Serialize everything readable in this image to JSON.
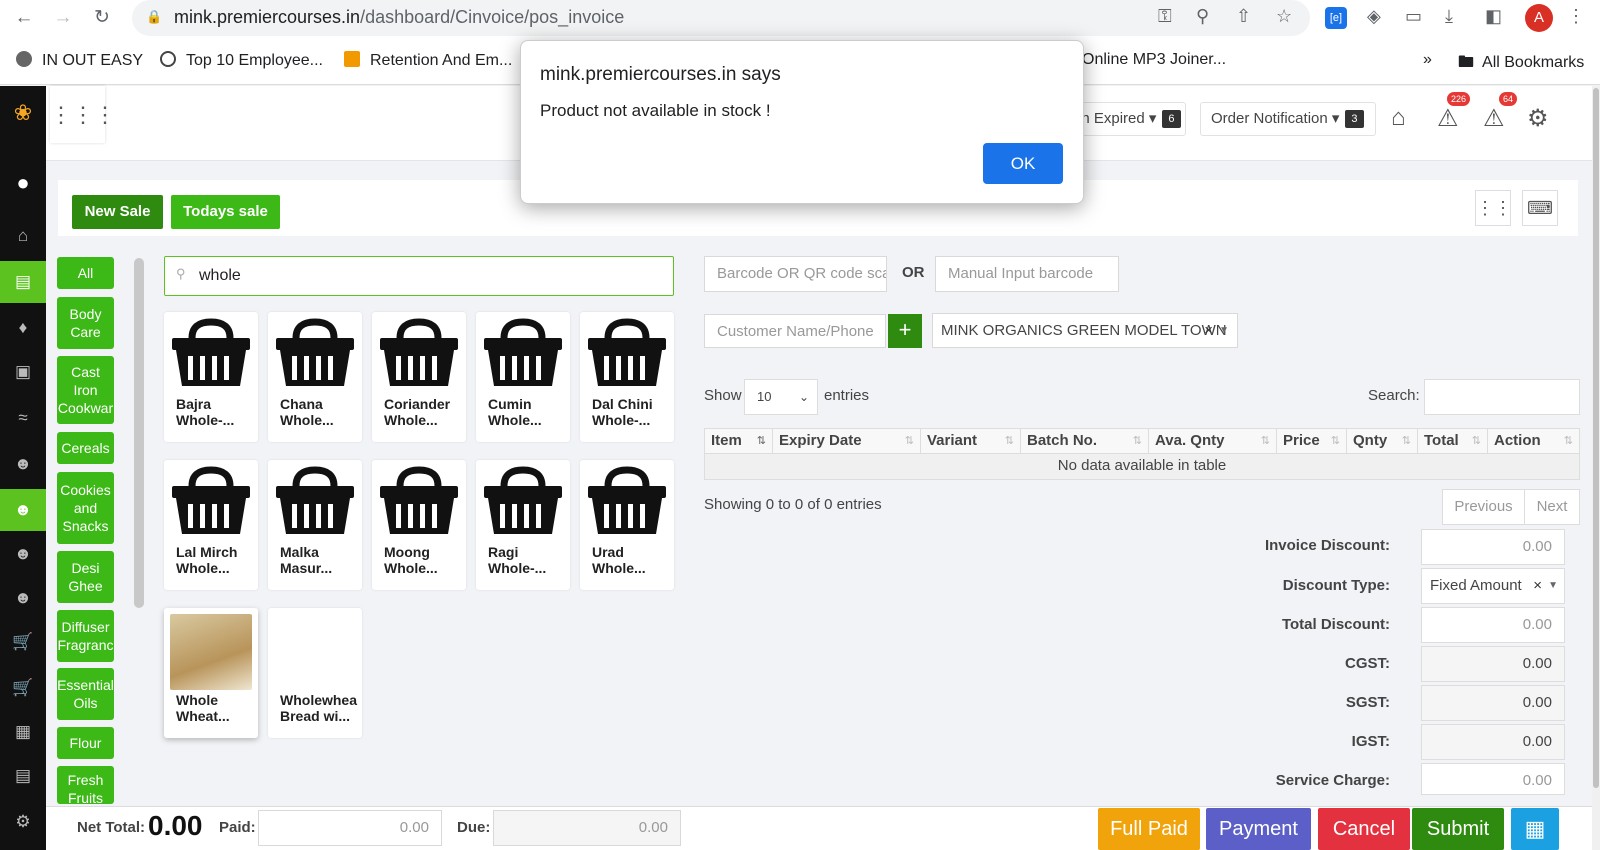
{
  "browser": {
    "url_host": "mink.premiercourses.in",
    "url_path": "/dashboard/Cinvoice/pos_invoice",
    "profile_initial": "A",
    "bookmarks": [
      "IN OUT EASY",
      "Top 10 Employee...",
      "Retention And Em...",
      "Online MP3 Joiner..."
    ],
    "bookmarks_overflow": "»",
    "all_bookmarks": "All Bookmarks",
    "extension_label": "[e]"
  },
  "header": {
    "expired_label": "on Expired",
    "expired_count": "6",
    "order_notification_label": "Order Notification",
    "order_notification_count": "3",
    "alert_badge_1": "226",
    "alert_badge_2": "64"
  },
  "actions": {
    "new_sale": "New Sale",
    "todays_sale": "Todays sale"
  },
  "categories": [
    "All",
    "Body Care",
    "Cast Iron Cookwar",
    "Cereals",
    "Cookies and Snacks",
    "Desi Ghee",
    "Diffuser Fragranc",
    "Essential Oils",
    "Flour",
    "Fresh Fruits"
  ],
  "search": {
    "value": "whole"
  },
  "products": [
    {
      "line1": "Bajra",
      "line2": "Whole-..."
    },
    {
      "line1": "Chana",
      "line2": "Whole..."
    },
    {
      "line1": "Coriander",
      "line2": "Whole..."
    },
    {
      "line1": "Cumin",
      "line2": "Whole..."
    },
    {
      "line1": "Dal Chini",
      "line2": "Whole-..."
    },
    {
      "line1": "Lal Mirch",
      "line2": "Whole..."
    },
    {
      "line1": "Malka",
      "line2": "Masur..."
    },
    {
      "line1": "Moong",
      "line2": "Whole..."
    },
    {
      "line1": "Ragi",
      "line2": "Whole-..."
    },
    {
      "line1": "Urad",
      "line2": "Whole..."
    },
    {
      "line1": "Whole",
      "line2": "Wheat..."
    },
    {
      "line1": "Wholewhea",
      "line2": "Bread wi..."
    }
  ],
  "invoice": {
    "barcode_placeholder": "Barcode OR QR code sca",
    "or_label": "OR",
    "manual_barcode_placeholder": "Manual Input barcode",
    "customer_placeholder": "Customer Name/Phone",
    "store": "MINK ORGANICS GREEN MODEL TOWN",
    "show_label": "Show",
    "show_value": "10",
    "entries_label": "entries",
    "search_label": "Search:",
    "columns": [
      "Item",
      "Expiry Date",
      "Variant",
      "Batch No.",
      "Ava. Qnty",
      "Price",
      "Qnty",
      "Total",
      "Action"
    ],
    "no_data": "No data available in table",
    "showing": "Showing 0 to 0 of 0 entries",
    "previous": "Previous",
    "next": "Next"
  },
  "totals": {
    "invoice_discount_label": "Invoice Discount:",
    "invoice_discount": "0.00",
    "discount_type_label": "Discount Type:",
    "discount_type": "Fixed Amount",
    "total_discount_label": "Total Discount:",
    "total_discount": "0.00",
    "cgst_label": "CGST:",
    "cgst": "0.00",
    "sgst_label": "SGST:",
    "sgst": "0.00",
    "igst_label": "IGST:",
    "igst": "0.00",
    "service_charge_label": "Service Charge:",
    "service_charge": "0.00"
  },
  "footer": {
    "net_total_label": "Net Total:",
    "net_total": "0.00",
    "paid_label": "Paid:",
    "paid": "0.00",
    "due_label": "Due:",
    "due": "0.00",
    "full_paid": "Full Paid",
    "payment": "Payment",
    "cancel": "Cancel",
    "submit": "Submit"
  },
  "dialog": {
    "title": "mink.premiercourses.in says",
    "message": "Product not available in stock !",
    "ok": "OK"
  },
  "colors": {
    "green": "#3cb916",
    "dark_green": "#2e8b0f",
    "orange": "#f0a30a",
    "purple": "#5b5fc7",
    "red": "#e3313f",
    "blue": "#1a73e8"
  }
}
